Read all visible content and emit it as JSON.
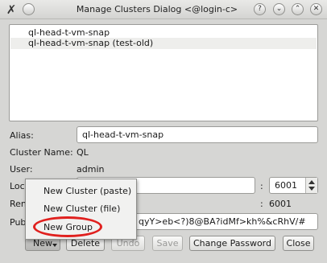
{
  "window": {
    "title": "Manage Clusters Dialog <@login-c>",
    "controls": {
      "help": "?",
      "minimize": "⌄",
      "maximize": "⌃",
      "close": "✕"
    }
  },
  "cluster_list": {
    "items": [
      {
        "label": "ql-head-t-vm-snap",
        "selected": false
      },
      {
        "label": "ql-head-t-vm-snap (test-old)",
        "selected": true
      }
    ]
  },
  "form": {
    "alias_label": "Alias:",
    "alias_value": "ql-head-t-vm-snap",
    "cluster_name_label": "Cluster Name:",
    "cluster_name_value": "QL",
    "user_label": "User:",
    "user_value": "admin",
    "local_label_partial": "Loc",
    "local_port_separator": ":",
    "local_port_value": "6001",
    "remote_label_partial": "Ren",
    "remote_port_separator": ":",
    "remote_port_value": "6001",
    "public_label_partial": "Pub",
    "public_value_partial": "qyY>eb<?)8@BA?idMf>kh%&cRhV/#"
  },
  "popup_menu": {
    "items": [
      "New Cluster (paste)",
      "New Cluster (file)",
      "New Group"
    ],
    "highlighted_item": "New Group",
    "highlight_color": "#e0201e"
  },
  "buttons": {
    "new": "New",
    "delete": "Delete",
    "undo": "Undo",
    "save": "Save",
    "change_password": "Change Password",
    "close": "Close"
  }
}
